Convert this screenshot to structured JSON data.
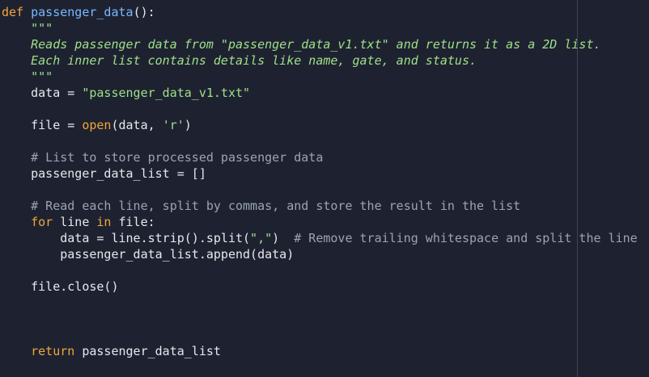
{
  "editor": {
    "lines": [
      {
        "tokens": [
          {
            "t": "def",
            "c": "kw"
          },
          {
            "t": " ",
            "c": "plain"
          },
          {
            "t": "passenger_data",
            "c": "fn"
          },
          {
            "t": "():",
            "c": "plain"
          }
        ]
      },
      {
        "tokens": [
          {
            "t": "    \"\"\"",
            "c": "doc"
          }
        ]
      },
      {
        "tokens": [
          {
            "t": "    Reads passenger data from \"passenger_data_v1.txt\" and returns it as a 2D list.",
            "c": "doc"
          }
        ]
      },
      {
        "tokens": [
          {
            "t": "    Each inner list contains details like name, gate, and status.",
            "c": "doc"
          }
        ]
      },
      {
        "tokens": [
          {
            "t": "    \"\"\"",
            "c": "doc"
          }
        ]
      },
      {
        "tokens": [
          {
            "t": "    data = ",
            "c": "plain"
          },
          {
            "t": "\"passenger_data_v1.txt\"",
            "c": "str"
          }
        ]
      },
      {
        "tokens": [
          {
            "t": "",
            "c": "plain"
          }
        ]
      },
      {
        "tokens": [
          {
            "t": "    file = ",
            "c": "plain"
          },
          {
            "t": "open",
            "c": "bi"
          },
          {
            "t": "(data, ",
            "c": "plain"
          },
          {
            "t": "'r'",
            "c": "str"
          },
          {
            "t": ")",
            "c": "plain"
          }
        ]
      },
      {
        "tokens": [
          {
            "t": "",
            "c": "plain"
          }
        ]
      },
      {
        "tokens": [
          {
            "t": "    # List to store processed passenger data",
            "c": "cmt"
          }
        ]
      },
      {
        "tokens": [
          {
            "t": "    passenger_data_list = []",
            "c": "plain"
          }
        ]
      },
      {
        "tokens": [
          {
            "t": "",
            "c": "plain"
          }
        ]
      },
      {
        "tokens": [
          {
            "t": "    # Read each line, split by commas, and store the result in the list",
            "c": "cmt"
          }
        ]
      },
      {
        "tokens": [
          {
            "t": "    ",
            "c": "plain"
          },
          {
            "t": "for",
            "c": "kw"
          },
          {
            "t": " line ",
            "c": "plain"
          },
          {
            "t": "in",
            "c": "kw"
          },
          {
            "t": " file:",
            "c": "plain"
          }
        ]
      },
      {
        "tokens": [
          {
            "t": "        data = line.strip().split(",
            "c": "plain"
          },
          {
            "t": "\",\"",
            "c": "str"
          },
          {
            "t": ")  ",
            "c": "plain"
          },
          {
            "t": "# Remove trailing whitespace and split the line",
            "c": "cmt"
          }
        ]
      },
      {
        "tokens": [
          {
            "t": "        passenger_data_list.append(data)",
            "c": "plain"
          }
        ]
      },
      {
        "tokens": [
          {
            "t": "",
            "c": "plain"
          }
        ]
      },
      {
        "tokens": [
          {
            "t": "    file.close()",
            "c": "plain"
          }
        ]
      },
      {
        "tokens": [
          {
            "t": "",
            "c": "plain"
          }
        ]
      },
      {
        "tokens": [
          {
            "t": "",
            "c": "plain"
          }
        ]
      },
      {
        "tokens": [
          {
            "t": "",
            "c": "plain"
          }
        ]
      },
      {
        "tokens": [
          {
            "t": "    ",
            "c": "plain"
          },
          {
            "t": "return",
            "c": "kw"
          },
          {
            "t": " passenger_data_list",
            "c": "plain"
          }
        ]
      }
    ]
  }
}
